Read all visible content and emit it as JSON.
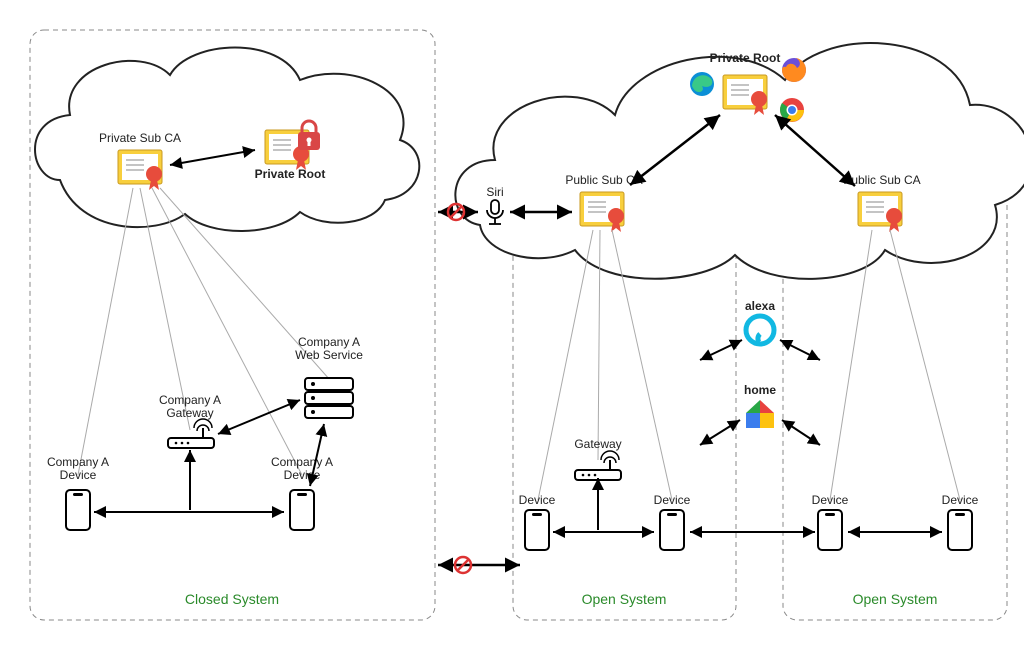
{
  "closed": {
    "system_label": "Closed System",
    "sub_ca": "Private Sub CA",
    "root": "Private Root",
    "gateway": "Company A\nGateway",
    "webservice": "Company A\nWeb Service",
    "deviceA": "Company A\nDevice",
    "deviceB": "Company A\nDevice"
  },
  "open1": {
    "system_label": "Open System",
    "sub_ca": "Public Sub CA",
    "gateway": "Gateway",
    "deviceA": "Device",
    "deviceB": "Device"
  },
  "open2": {
    "system_label": "Open System",
    "sub_ca": "Public Sub CA",
    "deviceA": "Device",
    "deviceB": "Device"
  },
  "root_public": "Private Root",
  "assistants": {
    "siri": "Siri",
    "alexa": "alexa",
    "home": "home"
  },
  "icons": {
    "cert": "certificate-icon",
    "lock": "lock-icon",
    "edge": "edge-browser-icon",
    "firefox": "firefox-browser-icon",
    "chrome": "chrome-browser-icon",
    "alexa": "alexa-icon",
    "home": "google-home-icon",
    "mic": "microphone-icon",
    "router": "router-icon",
    "server": "server-icon",
    "phone": "phone-icon",
    "prohibit": "prohibit-icon"
  }
}
